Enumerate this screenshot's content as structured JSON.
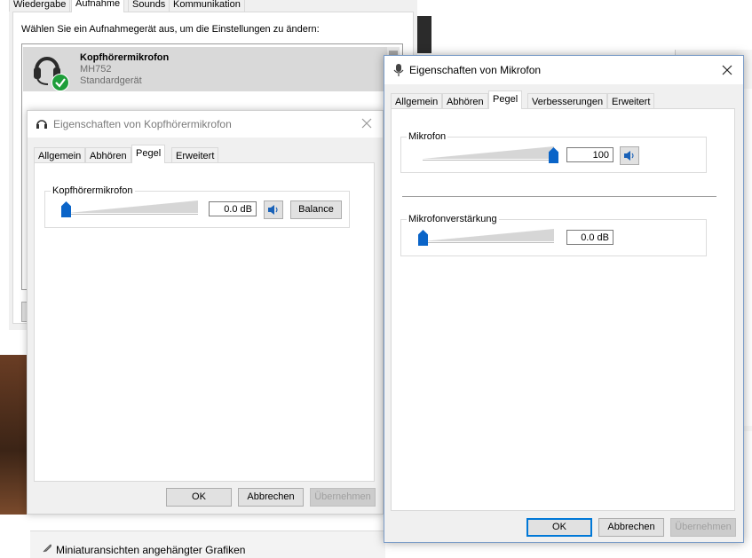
{
  "background_window": {
    "tabs": [
      "Wiedergabe",
      "Aufnahme",
      "Sounds",
      "Kommunikation"
    ],
    "active_tab_index": 1,
    "instruction": "Wählen Sie ein Aufnahmegerät aus, um die Einstellungen zu ändern:",
    "device": {
      "name": "Kopfhörermikrofon",
      "model": "MH752",
      "status": "Standardgerät"
    }
  },
  "headset_dialog": {
    "title": "Eigenschaften von Kopfhörermikrofon",
    "tabs": [
      "Allgemein",
      "Abhören",
      "Pegel",
      "Erweitert"
    ],
    "active_tab_index": 2,
    "level_group": {
      "label": "Kopfhörermikrofon",
      "value_text": "0.0 dB",
      "slider_fraction": 0.0,
      "balance_label": "Balance"
    },
    "buttons": {
      "ok": "OK",
      "cancel": "Abbrechen",
      "apply": "Übernehmen"
    }
  },
  "mic_dialog": {
    "title": "Eigenschaften von Mikrofon",
    "tabs": [
      "Allgemein",
      "Abhören",
      "Pegel",
      "Verbesserungen",
      "Erweitert"
    ],
    "active_tab_index": 2,
    "level_group": {
      "label": "Mikrofon",
      "value_text": "100",
      "slider_fraction": 1.0
    },
    "boost_group": {
      "label": "Mikrofonverstärkung",
      "value_text": "0.0 dB",
      "slider_fraction": 0.0
    },
    "buttons": {
      "ok": "OK",
      "cancel": "Abbrechen",
      "apply": "Übernehmen"
    }
  },
  "bottom_bar": {
    "label": "Miniaturansichten angehängter Grafiken"
  },
  "colors": {
    "accent": "#0078d7",
    "slider_thumb": "#0a64c8",
    "ok_green": "#1e9e3a",
    "dialog_bg": "#f0f0f0"
  }
}
